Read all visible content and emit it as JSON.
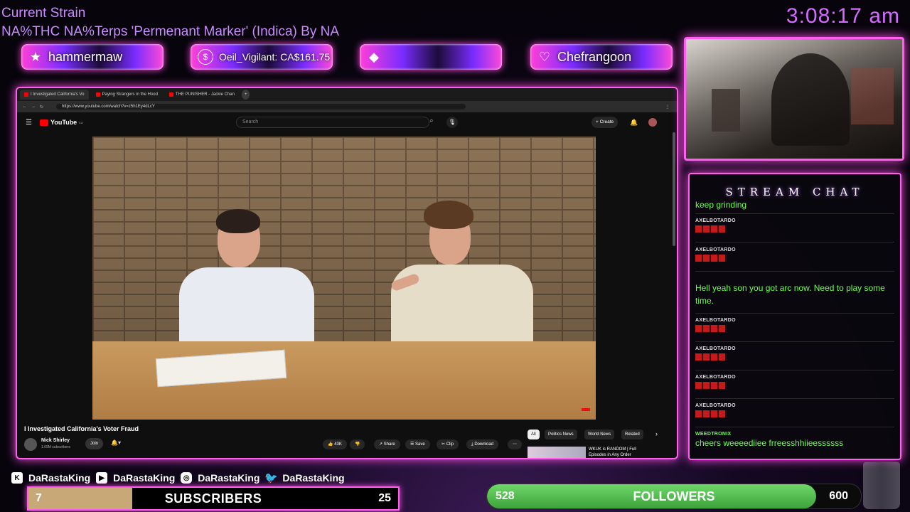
{
  "header": {
    "strain_title": "Current Strain",
    "strain_detail": "NA%THC NA%Terps 'Permenant Marker' (Indica) By NA",
    "clock": "3:08:17 am"
  },
  "alerts": [
    {
      "icon": "star-icon",
      "glyph": "★",
      "text": "hammermaw"
    },
    {
      "icon": "dollar-icon",
      "glyph": "$",
      "text": "Oeil_Vigilant: CA$161.75"
    },
    {
      "icon": "diamond-icon",
      "glyph": "◆",
      "text": ""
    },
    {
      "icon": "heart-icon",
      "glyph": "♡",
      "text": "Chefrangoon"
    }
  ],
  "browser": {
    "tabs": [
      {
        "label": "I Investigated California's Vo",
        "active": true
      },
      {
        "label": "Paying Strangers in the Hood",
        "active": false
      },
      {
        "label": "THE PUNISHER - Jackie Chan",
        "active": false
      }
    ],
    "url": "https://www.youtube.com/watch?v=z5h1Ey4dLcY",
    "youtube": {
      "logo_text": "YouTube",
      "logo_region": "CA",
      "search_placeholder": "Search",
      "create_label": "+ Create",
      "video_title": "I Investigated California's Voter Fraud",
      "channel_name": "Nick Shirley",
      "channel_subs": "1.69M subscribers",
      "join_label": "Join",
      "likes": "43K",
      "share_label": "Share",
      "save_label": "Save",
      "clip_label": "Clip",
      "download_label": "Download",
      "chips": [
        "All",
        "Politics News",
        "World News",
        "Related"
      ],
      "rec_title": "WKUK is RANDOM | Full Episodes in Any Order"
    }
  },
  "chat": {
    "title": "STREAM CHAT",
    "partial_text": "keep grinding",
    "messages": [
      {
        "user": "AXELBOTARDO",
        "text": "",
        "emote": true
      },
      {
        "user": "AXELBOTARDO",
        "text": "",
        "emote": true
      },
      {
        "user": "",
        "text": "Hell yeah son you got arc now. Need to play some time.",
        "emote": false
      },
      {
        "user": "AXELBOTARDO",
        "text": "",
        "emote": true
      },
      {
        "user": "AXELBOTARDO",
        "text": "",
        "emote": true
      },
      {
        "user": "AXELBOTARDO",
        "text": "",
        "emote": true
      },
      {
        "user": "AXELBOTARDO",
        "text": "",
        "emote": true
      },
      {
        "user": "WEEDTRONIX",
        "text": "cheers weeeediiee frreesshhiieessssss",
        "emote": false
      }
    ]
  },
  "socials": {
    "kick": "DaRastaKing",
    "youtube": "DaRastaKing",
    "instagram": "DaRastaKing",
    "twitter": "DaRastaKing"
  },
  "subscribers": {
    "label": "SUBSCRIBERS",
    "current": "7",
    "goal": "25",
    "progress": 0.28
  },
  "followers": {
    "label": "FOLLOWERS",
    "current": "528",
    "goal": "600",
    "progress": 0.88
  },
  "colors": {
    "accent": "#ff5ef0",
    "chat_text": "#6dff4d",
    "clock": "#d46bff",
    "strain": "#c98bff"
  }
}
